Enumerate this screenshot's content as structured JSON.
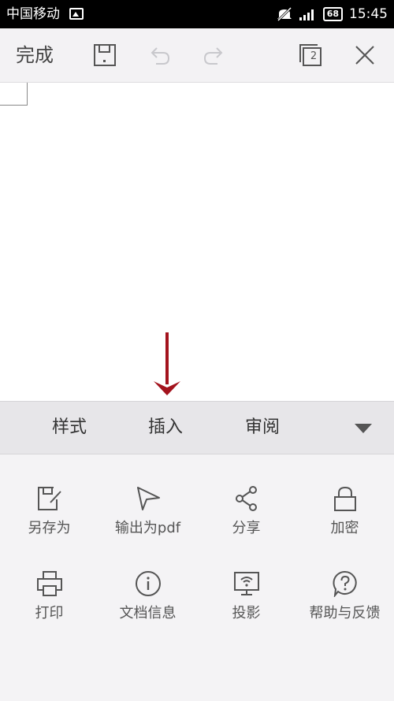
{
  "status_bar": {
    "carrier": "中国移动",
    "battery": "68",
    "time": "15:45"
  },
  "toolbar": {
    "done_label": "完成",
    "page_count": "2"
  },
  "tabs": [
    {
      "label": "样式"
    },
    {
      "label": "插入"
    },
    {
      "label": "审阅"
    }
  ],
  "actions": [
    {
      "label": "另存为",
      "icon": "save-as-icon"
    },
    {
      "label": "输出为pdf",
      "icon": "export-pdf-icon"
    },
    {
      "label": "分享",
      "icon": "share-icon"
    },
    {
      "label": "加密",
      "icon": "lock-icon"
    },
    {
      "label": "打印",
      "icon": "print-icon"
    },
    {
      "label": "文档信息",
      "icon": "info-icon"
    },
    {
      "label": "投影",
      "icon": "projection-icon"
    },
    {
      "label": "帮助与反馈",
      "icon": "help-icon"
    }
  ],
  "colors": {
    "arrow": "#a3131d",
    "icon_gray": "#555555"
  }
}
